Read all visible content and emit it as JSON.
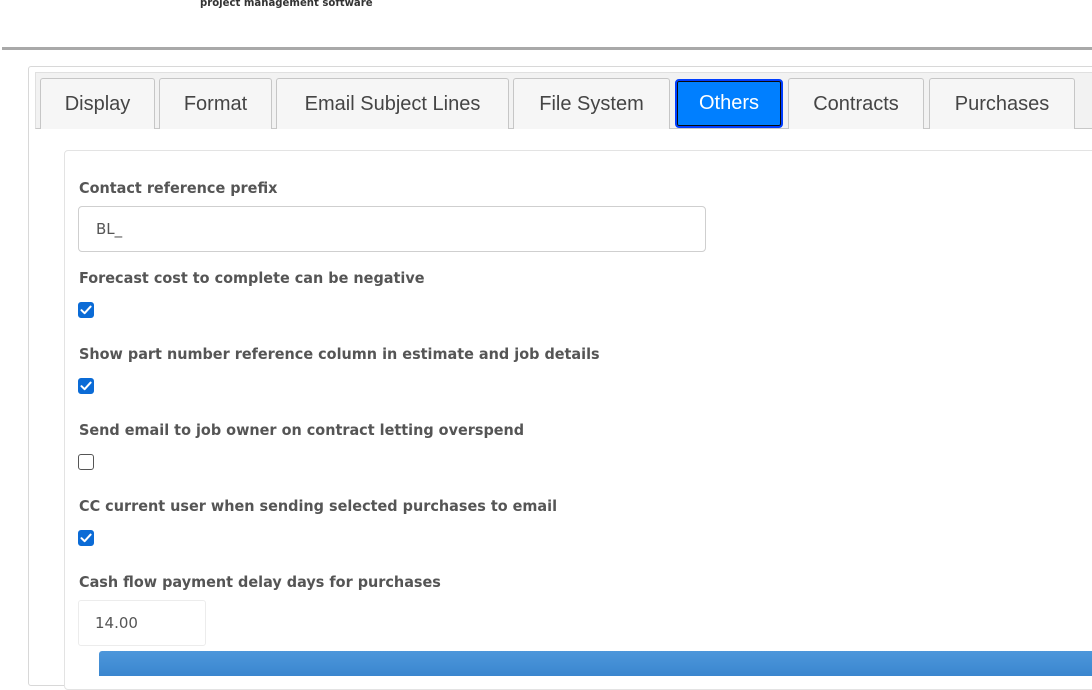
{
  "brand": {
    "tagline": "project management software"
  },
  "tabs": [
    {
      "label": "Display",
      "active": false
    },
    {
      "label": "Format",
      "active": false
    },
    {
      "label": "Email Subject Lines",
      "active": false
    },
    {
      "label": "File System",
      "active": false
    },
    {
      "label": "Others",
      "active": true
    },
    {
      "label": "Contracts",
      "active": false
    },
    {
      "label": "Purchases",
      "active": false
    }
  ],
  "settings": {
    "contact_prefix": {
      "label": "Contact reference prefix",
      "value": "BL_"
    },
    "forecast_negative": {
      "label": "Forecast cost to complete can be negative",
      "checked": true
    },
    "show_part_number": {
      "label": "Show part number reference column in estimate and job details",
      "checked": true
    },
    "email_overspend": {
      "label": "Send email to job owner on contract letting overspend",
      "checked": false
    },
    "cc_current_user": {
      "label": "CC current user when sending selected purchases to email",
      "checked": true
    },
    "cash_flow_delay": {
      "label": "Cash flow payment delay days for purchases",
      "value": "14.00"
    }
  },
  "colors": {
    "accent": "#007fff",
    "checkbox": "#0b6bd6",
    "save_bar": "#3a86cf"
  }
}
